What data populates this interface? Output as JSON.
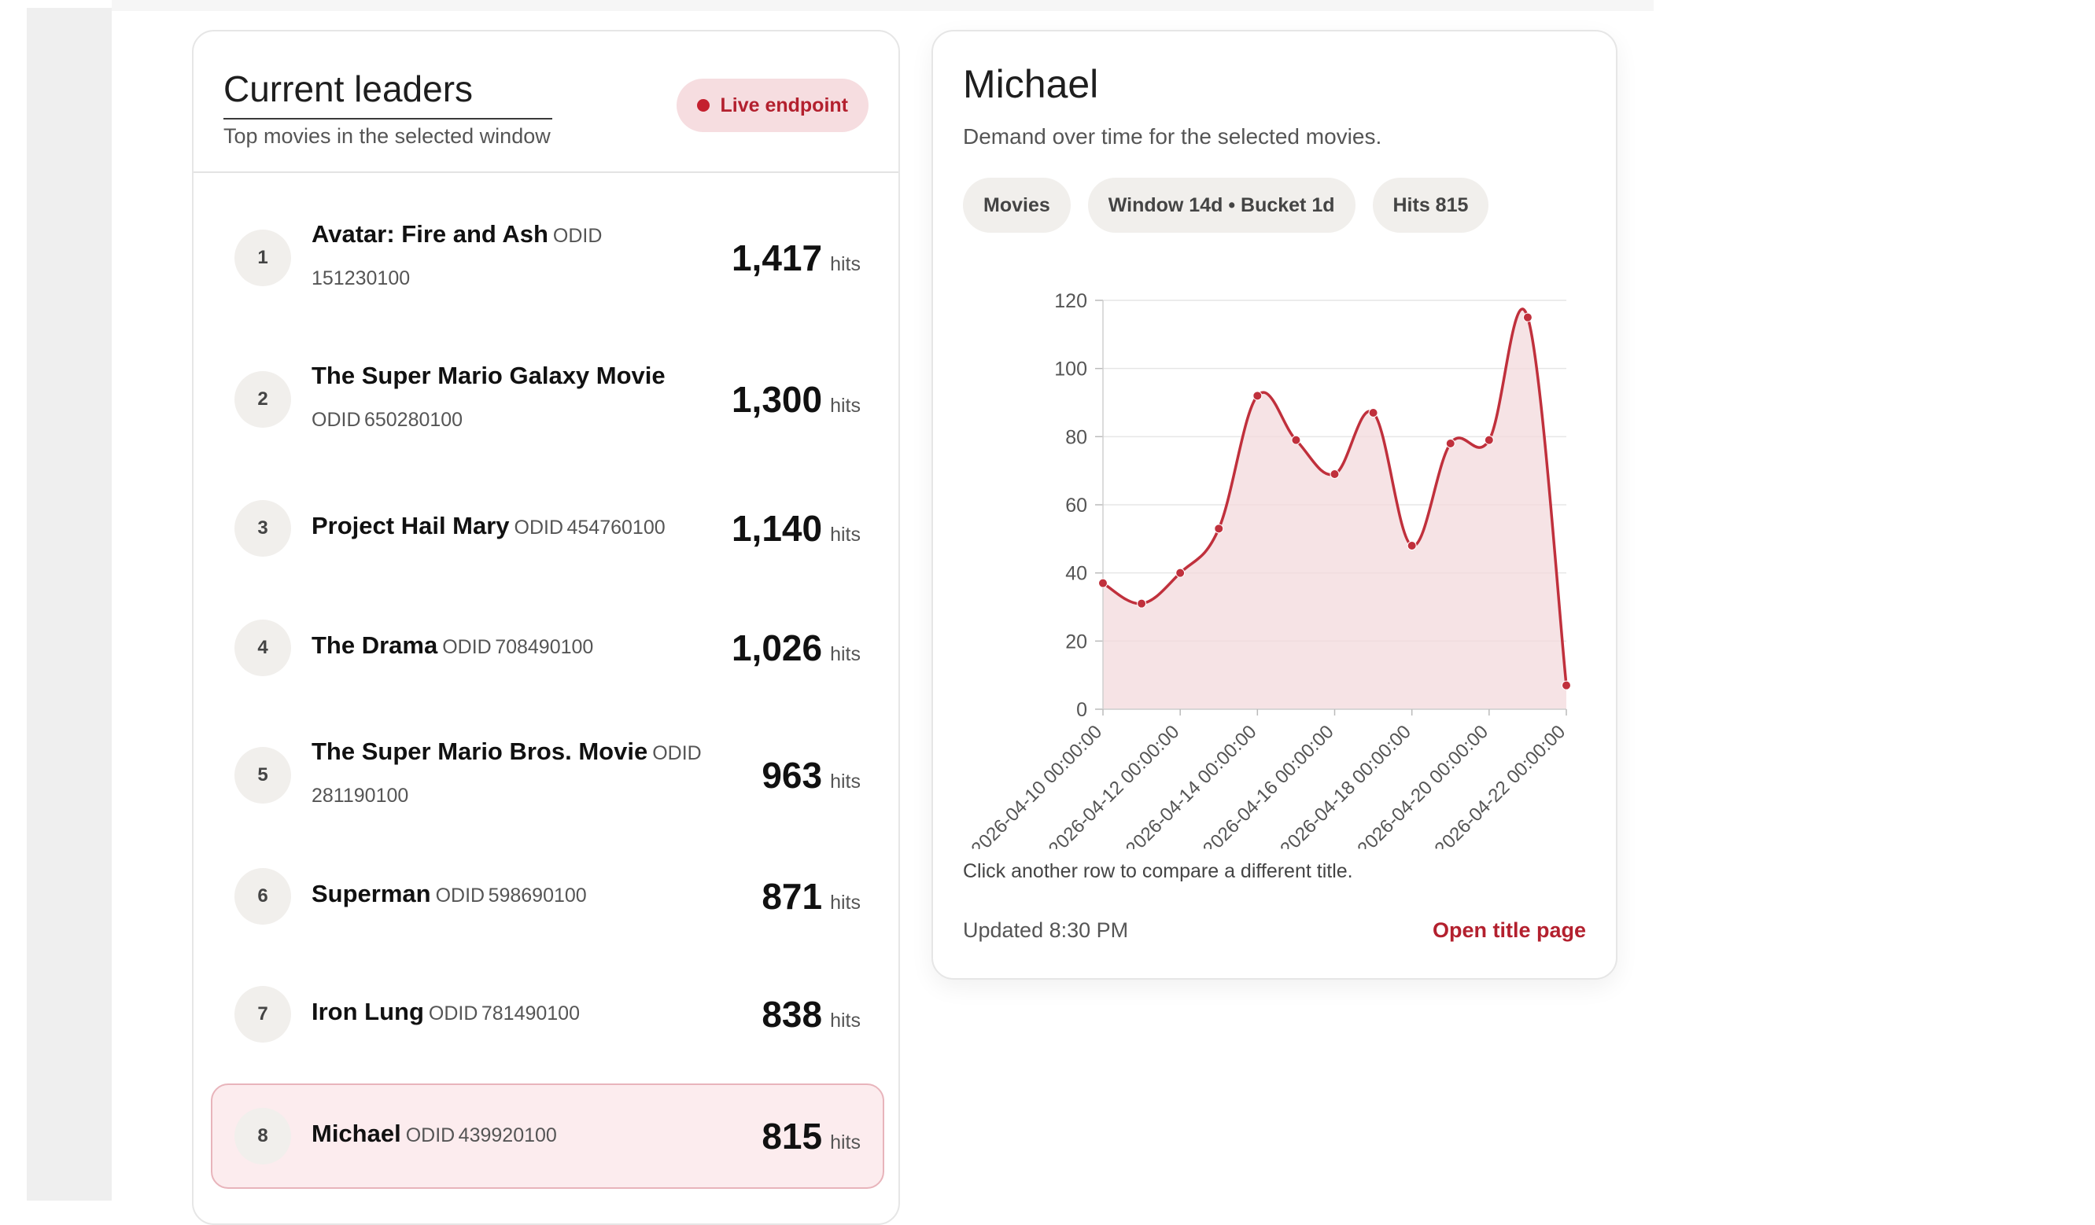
{
  "leaders": {
    "title": "Current leaders",
    "subtitle": "Top movies in the selected window",
    "badge": "Live endpoint",
    "hits_unit": "hits",
    "rows": [
      {
        "rank": "1",
        "name": "Avatar: Fire and Ash",
        "odid_label": "ODID",
        "odid": "151230100",
        "hits": "1,417"
      },
      {
        "rank": "2",
        "name": "The Super Mario Galaxy Movie",
        "odid_label": "ODID",
        "odid": "650280100",
        "hits": "1,300"
      },
      {
        "rank": "3",
        "name": "Project Hail Mary",
        "odid_label": "ODID",
        "odid": "454760100",
        "hits": "1,140"
      },
      {
        "rank": "4",
        "name": "The Drama",
        "odid_label": "ODID",
        "odid": "708490100",
        "hits": "1,026"
      },
      {
        "rank": "5",
        "name": "The Super Mario Bros. Movie",
        "odid_label": "ODID",
        "odid": "281190100",
        "hits": "963"
      },
      {
        "rank": "6",
        "name": "Superman",
        "odid_label": "ODID",
        "odid": "598690100",
        "hits": "871"
      },
      {
        "rank": "7",
        "name": "Iron Lung",
        "odid_label": "ODID",
        "odid": "781490100",
        "hits": "838"
      },
      {
        "rank": "8",
        "name": "Michael",
        "odid_label": "ODID",
        "odid": "439920100",
        "hits": "815",
        "selected": true
      }
    ]
  },
  "detail": {
    "title": "Michael",
    "subtitle": "Demand over time for the selected movies.",
    "chips": [
      "Movies",
      "Window 14d • Bucket 1d",
      "Hits 815"
    ],
    "note": "Click another row to compare a different title.",
    "updated": "Updated 8:30 PM",
    "open_link": "Open title page"
  },
  "colors": {
    "accent": "#b3202e",
    "line": "#c0303c",
    "area": "#f3d9dc",
    "badge_bg": "#f6dde0",
    "selected_row_bg": "#fcecee"
  },
  "chart_data": {
    "type": "area",
    "title": "",
    "xlabel": "",
    "ylabel": "",
    "ylim": [
      0,
      120
    ],
    "yticks": [
      "0",
      "20",
      "40",
      "60",
      "80",
      "100",
      "120"
    ],
    "xtick_labels": [
      "2026-04-10 00:00:00",
      "2026-04-12 00:00:00",
      "2026-04-14 00:00:00",
      "2026-04-16 00:00:00",
      "2026-04-18 00:00:00",
      "2026-04-20 00:00:00",
      "2026-04-22 00:00:00"
    ],
    "x": [
      "2026-04-10",
      "2026-04-11",
      "2026-04-12",
      "2026-04-13",
      "2026-04-14",
      "2026-04-15",
      "2026-04-16",
      "2026-04-17",
      "2026-04-18",
      "2026-04-19",
      "2026-04-20",
      "2026-04-21",
      "2026-04-22"
    ],
    "series": [
      {
        "values": [
          37,
          31,
          40,
          53,
          92,
          79,
          69,
          87,
          48,
          78,
          79,
          115,
          7
        ]
      }
    ],
    "grid": true,
    "legend": "none"
  }
}
